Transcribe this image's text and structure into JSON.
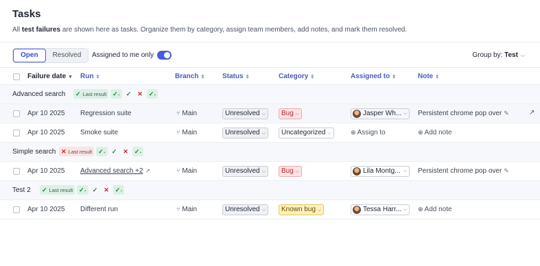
{
  "header": {
    "title": "Tasks",
    "desc_prefix": "All ",
    "desc_bold": "test failures",
    "desc_suffix": " are shown here as tasks. Organize them by category, assign team members, add notes, and mark them resolved."
  },
  "toolbar": {
    "tabs": [
      "Open",
      "Resolved"
    ],
    "active_tab": "Open",
    "assigned_label": "Assigned to me only",
    "assigned_toggle_on": true,
    "groupby_label": "Group by:",
    "groupby_value": "Test"
  },
  "columns": {
    "failure_date": "Failure date",
    "run": "Run",
    "branch": "Branch",
    "status": "Status",
    "category": "Category",
    "assigned_to": "Assigned to",
    "note": "Note"
  },
  "last_result_label": "Last result",
  "groups": [
    {
      "name": "Advanced search",
      "results": [
        "pass",
        "flaky",
        "pass",
        "fail",
        "flaky"
      ],
      "rows": [
        {
          "date": "Apr 10 2025",
          "run": "Regression suite",
          "branch": "Main",
          "status": "Unresolved",
          "category": "Bug",
          "assignee": "Jasper Wh...",
          "note": "Persistent chrome pop over"
        },
        {
          "date": "Apr 10 2025",
          "run": "Smoke suite",
          "branch": "Main",
          "status": "Unresolved",
          "category": "Uncategorized",
          "assign_label": "Assign to",
          "add_note_label": "Add note"
        }
      ]
    },
    {
      "name": "Simple search",
      "results": [
        "fail",
        "flaky",
        "pass",
        "fail",
        "flaky"
      ],
      "rows": [
        {
          "date": "Apr 10 2025",
          "run": "Advanced search +2",
          "branch": "Main",
          "status": "Unresolved",
          "category": "Bug",
          "assignee": "Lila Montg...",
          "note": "Persistent chrome pop over"
        }
      ]
    },
    {
      "name": "Test 2",
      "results": [
        "pass",
        "flaky",
        "pass",
        "fail",
        "flaky"
      ],
      "rows": [
        {
          "date": "Apr 10 2025",
          "run": "Different run",
          "branch": "Main",
          "status": "Unresolved",
          "category": "Known bug",
          "assignee": "Tessa Harr...",
          "add_note_label": "Add note"
        }
      ]
    }
  ],
  "colors": {
    "accent": "#4b5be0",
    "pass_bg": "#dbf1e4",
    "fail_bg": "#fde3e3",
    "bug_bg": "#fde3e3",
    "known_bug_bg": "#fff1bf"
  }
}
